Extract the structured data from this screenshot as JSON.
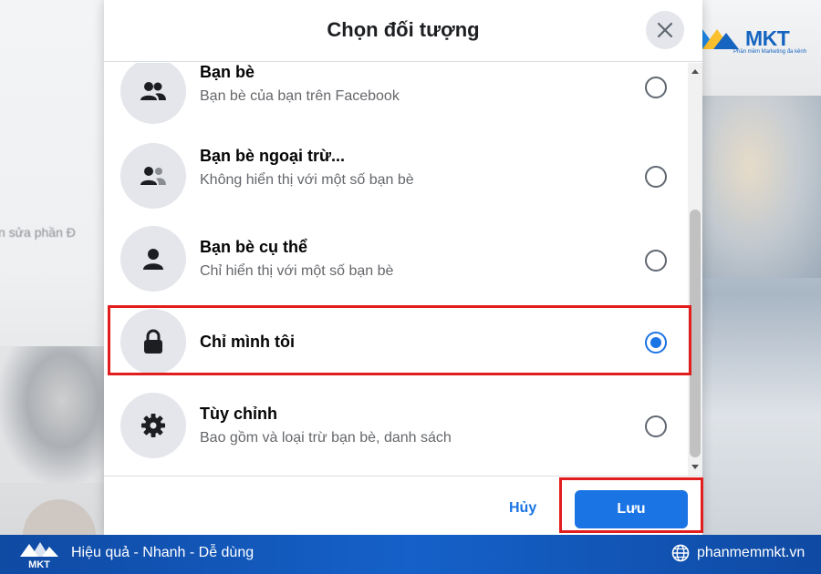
{
  "background": {
    "left_fragment_text": "n sửa phần Đ"
  },
  "brand": {
    "name": "MKT",
    "tagline_small": "Phần mềm Marketing đa kênh",
    "accent_color": "#1565c0"
  },
  "dialog": {
    "title": "Chọn đối tượng",
    "close_icon": "close-icon",
    "options": [
      {
        "title": "Bạn bè",
        "subtitle": "Bạn bè của bạn trên Facebook",
        "icon": "friends-icon",
        "selected": false
      },
      {
        "title": "Bạn bè ngoại trừ...",
        "subtitle": "Không hiển thị với một số bạn bè",
        "icon": "friends-except-icon",
        "selected": false
      },
      {
        "title": "Bạn bè cụ thể",
        "subtitle": "Chỉ hiển thị với một số bạn bè",
        "icon": "person-icon",
        "selected": false
      },
      {
        "title": "Chỉ mình tôi",
        "subtitle": "",
        "icon": "lock-icon",
        "selected": true
      },
      {
        "title": "Tùy chỉnh",
        "subtitle": "Bao gồm và loại trừ bạn bè, danh sách",
        "icon": "gear-icon",
        "selected": false
      }
    ],
    "cancel_label": "Hủy",
    "save_label": "Lưu",
    "primary_color": "#1b74e4",
    "highlight_color": "#e11d1d"
  },
  "banner": {
    "logo_text": "MKT",
    "tagline": "Hiệu quả - Nhanh - Dễ dùng",
    "website": "phanmemmkt.vn",
    "background_color": "#1561c9"
  }
}
